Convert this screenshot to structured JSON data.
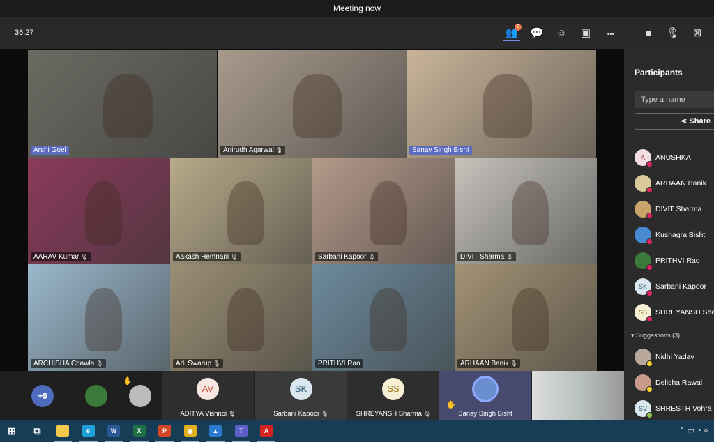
{
  "window": {
    "title": "Meeting now"
  },
  "toolbar": {
    "timer": "36:27",
    "participants_badge": "2",
    "buttons": [
      {
        "name": "participants-button",
        "icon": "people-icon",
        "glyph": "👥"
      },
      {
        "name": "chat-button",
        "icon": "chat-icon",
        "glyph": "💬"
      },
      {
        "name": "reactions-button",
        "icon": "reactions-icon",
        "glyph": "☺"
      },
      {
        "name": "rooms-button",
        "icon": "breakout-rooms-icon",
        "glyph": "▣"
      },
      {
        "name": "more-button",
        "icon": "more-icon",
        "glyph": "•••"
      },
      {
        "name": "camera-button",
        "icon": "camera-icon",
        "glyph": "■"
      },
      {
        "name": "mic-button",
        "icon": "mic-icon",
        "glyph": "🎙"
      },
      {
        "name": "share-screen-button",
        "icon": "share-tray-icon",
        "glyph": "⊠"
      }
    ]
  },
  "videos": [
    {
      "name": "Arshi Goel",
      "color": "#6b6a62",
      "highlight": true
    },
    {
      "name": "Anirudh Agarwal",
      "color": "#a89a8c",
      "mic": true
    },
    {
      "name": "Sanay  Singh Bisht",
      "color": "#c9b49a",
      "highlight": true
    },
    {
      "name": "AARAV  Kumar",
      "color": "#8a3a5a",
      "mic": true
    },
    {
      "name": "Aakash  Hemnani",
      "color": "#b8ab8a",
      "mic": true
    },
    {
      "name": "Sarbani   Kapoor",
      "color": "#b59a8a",
      "mic": true
    },
    {
      "name": "DIVIT  Sharma",
      "color": "#c6c3bc",
      "mic": true
    },
    {
      "name": "ARCHISHA  Chawla",
      "color": "#9ab8cc",
      "mic": true
    },
    {
      "name": "Adi  Swarup",
      "color": "#9a8e74",
      "mic": true
    },
    {
      "name": "PRITHVI  Rao",
      "color": "#6c8a9c"
    },
    {
      "name": "ARHAAN  Banik",
      "color": "#a39274",
      "mic": true
    }
  ],
  "panel": {
    "title": "Participants",
    "search_placeholder": "Type a name",
    "share_label": "Share",
    "participants": [
      {
        "name": "ANUSHKA",
        "initials": "A",
        "bg": "#f3dde3",
        "fg": "#a4485e",
        "status": "#e0245e"
      },
      {
        "name": "ARHAAN Banik",
        "initials": "",
        "bg": "#d8c89a",
        "status": "#e0245e"
      },
      {
        "name": "DIVIT Sharma",
        "initials": "",
        "bg": "#c8a46a",
        "status": "#e0245e"
      },
      {
        "name": "Kushagra Bisht",
        "initials": "",
        "bg": "#4a8ad0",
        "status": "#e0245e"
      },
      {
        "name": "PRITHVI Rao",
        "initials": "",
        "bg": "#3a7a3a",
        "status": "#e0245e"
      },
      {
        "name": "Sarbani Kapoor",
        "initials": "SK",
        "bg": "#dbe7ee",
        "fg": "#356178",
        "status": "#e0245e"
      },
      {
        "name": "SHREYANSH Sharma",
        "initials": "SS",
        "bg": "#f6efd6",
        "fg": "#9a7a18",
        "status": "#e0245e"
      }
    ],
    "suggestions_label": "Suggestions (3)",
    "suggestions": [
      {
        "name": "Nidhi Yadav",
        "initials": "",
        "bg": "#b9a79a",
        "status": "#f8d22a"
      },
      {
        "name": "Delisha Rawal",
        "initials": "",
        "bg": "#c79a8a",
        "status": "#f8d22a"
      },
      {
        "name": "SHRESTH Vohra",
        "initials": "SV",
        "bg": "#dbe7ee",
        "fg": "#356178",
        "status": "#92c353"
      }
    ]
  },
  "strip": {
    "overflow": "+9",
    "tiles": [
      {
        "name": "ADITYA Vishnoi",
        "initials": "AV",
        "bg": "#f8e6e2",
        "fg": "#c4543a"
      },
      {
        "name": "Sarbani Kapoor",
        "initials": "SK",
        "bg": "#dbe7ee",
        "fg": "#356178"
      },
      {
        "name": "SHREYANSH Sharma",
        "initials": "SS",
        "bg": "#f6efd6",
        "fg": "#9a7a18"
      },
      {
        "name": "Sanay Singh Bisht",
        "initials": "",
        "bg": "#6a8ed0",
        "fg": "#fff"
      }
    ]
  },
  "taskbar": {
    "apps": [
      {
        "name": "start",
        "icon": "windows-icon",
        "glyph": "⊞",
        "bg": "transparent"
      },
      {
        "name": "task-view",
        "icon": "task-view-icon",
        "glyph": "⧉",
        "bg": "transparent"
      },
      {
        "name": "file-explorer",
        "icon": "folder-icon",
        "glyph": "",
        "bg": "#f2c94c"
      },
      {
        "name": "edge",
        "icon": "edge-icon",
        "glyph": "e",
        "bg": "#1fa0d8"
      },
      {
        "name": "word",
        "icon": "word-icon",
        "glyph": "W",
        "bg": "#2b5797"
      },
      {
        "name": "excel",
        "icon": "excel-icon",
        "glyph": "X",
        "bg": "#1e7145"
      },
      {
        "name": "powerpoint",
        "icon": "powerpoint-icon",
        "glyph": "P",
        "bg": "#d24726"
      },
      {
        "name": "chrome",
        "icon": "chrome-icon",
        "glyph": "◉",
        "bg": "#e0b020"
      },
      {
        "name": "photos",
        "icon": "photos-icon",
        "glyph": "▲",
        "bg": "#2a7ad0"
      },
      {
        "name": "teams",
        "icon": "teams-icon",
        "glyph": "T",
        "bg": "#5b5fc7"
      },
      {
        "name": "acrobat",
        "icon": "acrobat-icon",
        "glyph": "A",
        "bg": "#d4221e"
      }
    ]
  }
}
